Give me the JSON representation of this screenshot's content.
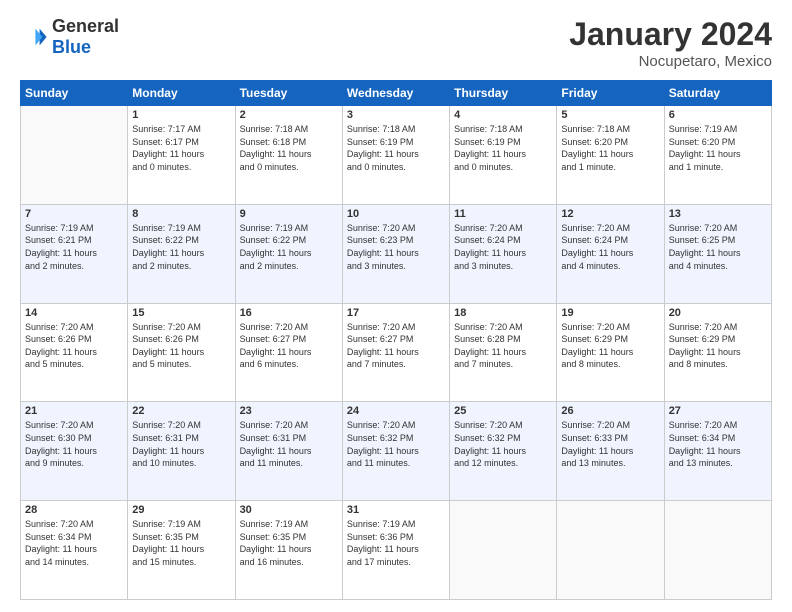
{
  "header": {
    "logo_general": "General",
    "logo_blue": "Blue",
    "month": "January 2024",
    "location": "Nocupetaro, Mexico"
  },
  "weekdays": [
    "Sunday",
    "Monday",
    "Tuesday",
    "Wednesday",
    "Thursday",
    "Friday",
    "Saturday"
  ],
  "weeks": [
    [
      {
        "day": "",
        "info": ""
      },
      {
        "day": "1",
        "info": "Sunrise: 7:17 AM\nSunset: 6:17 PM\nDaylight: 11 hours\nand 0 minutes."
      },
      {
        "day": "2",
        "info": "Sunrise: 7:18 AM\nSunset: 6:18 PM\nDaylight: 11 hours\nand 0 minutes."
      },
      {
        "day": "3",
        "info": "Sunrise: 7:18 AM\nSunset: 6:19 PM\nDaylight: 11 hours\nand 0 minutes."
      },
      {
        "day": "4",
        "info": "Sunrise: 7:18 AM\nSunset: 6:19 PM\nDaylight: 11 hours\nand 0 minutes."
      },
      {
        "day": "5",
        "info": "Sunrise: 7:18 AM\nSunset: 6:20 PM\nDaylight: 11 hours\nand 1 minute."
      },
      {
        "day": "6",
        "info": "Sunrise: 7:19 AM\nSunset: 6:20 PM\nDaylight: 11 hours\nand 1 minute."
      }
    ],
    [
      {
        "day": "7",
        "info": "Sunrise: 7:19 AM\nSunset: 6:21 PM\nDaylight: 11 hours\nand 2 minutes."
      },
      {
        "day": "8",
        "info": "Sunrise: 7:19 AM\nSunset: 6:22 PM\nDaylight: 11 hours\nand 2 minutes."
      },
      {
        "day": "9",
        "info": "Sunrise: 7:19 AM\nSunset: 6:22 PM\nDaylight: 11 hours\nand 2 minutes."
      },
      {
        "day": "10",
        "info": "Sunrise: 7:20 AM\nSunset: 6:23 PM\nDaylight: 11 hours\nand 3 minutes."
      },
      {
        "day": "11",
        "info": "Sunrise: 7:20 AM\nSunset: 6:24 PM\nDaylight: 11 hours\nand 3 minutes."
      },
      {
        "day": "12",
        "info": "Sunrise: 7:20 AM\nSunset: 6:24 PM\nDaylight: 11 hours\nand 4 minutes."
      },
      {
        "day": "13",
        "info": "Sunrise: 7:20 AM\nSunset: 6:25 PM\nDaylight: 11 hours\nand 4 minutes."
      }
    ],
    [
      {
        "day": "14",
        "info": "Sunrise: 7:20 AM\nSunset: 6:26 PM\nDaylight: 11 hours\nand 5 minutes."
      },
      {
        "day": "15",
        "info": "Sunrise: 7:20 AM\nSunset: 6:26 PM\nDaylight: 11 hours\nand 5 minutes."
      },
      {
        "day": "16",
        "info": "Sunrise: 7:20 AM\nSunset: 6:27 PM\nDaylight: 11 hours\nand 6 minutes."
      },
      {
        "day": "17",
        "info": "Sunrise: 7:20 AM\nSunset: 6:27 PM\nDaylight: 11 hours\nand 7 minutes."
      },
      {
        "day": "18",
        "info": "Sunrise: 7:20 AM\nSunset: 6:28 PM\nDaylight: 11 hours\nand 7 minutes."
      },
      {
        "day": "19",
        "info": "Sunrise: 7:20 AM\nSunset: 6:29 PM\nDaylight: 11 hours\nand 8 minutes."
      },
      {
        "day": "20",
        "info": "Sunrise: 7:20 AM\nSunset: 6:29 PM\nDaylight: 11 hours\nand 8 minutes."
      }
    ],
    [
      {
        "day": "21",
        "info": "Sunrise: 7:20 AM\nSunset: 6:30 PM\nDaylight: 11 hours\nand 9 minutes."
      },
      {
        "day": "22",
        "info": "Sunrise: 7:20 AM\nSunset: 6:31 PM\nDaylight: 11 hours\nand 10 minutes."
      },
      {
        "day": "23",
        "info": "Sunrise: 7:20 AM\nSunset: 6:31 PM\nDaylight: 11 hours\nand 11 minutes."
      },
      {
        "day": "24",
        "info": "Sunrise: 7:20 AM\nSunset: 6:32 PM\nDaylight: 11 hours\nand 11 minutes."
      },
      {
        "day": "25",
        "info": "Sunrise: 7:20 AM\nSunset: 6:32 PM\nDaylight: 11 hours\nand 12 minutes."
      },
      {
        "day": "26",
        "info": "Sunrise: 7:20 AM\nSunset: 6:33 PM\nDaylight: 11 hours\nand 13 minutes."
      },
      {
        "day": "27",
        "info": "Sunrise: 7:20 AM\nSunset: 6:34 PM\nDaylight: 11 hours\nand 13 minutes."
      }
    ],
    [
      {
        "day": "28",
        "info": "Sunrise: 7:20 AM\nSunset: 6:34 PM\nDaylight: 11 hours\nand 14 minutes."
      },
      {
        "day": "29",
        "info": "Sunrise: 7:19 AM\nSunset: 6:35 PM\nDaylight: 11 hours\nand 15 minutes."
      },
      {
        "day": "30",
        "info": "Sunrise: 7:19 AM\nSunset: 6:35 PM\nDaylight: 11 hours\nand 16 minutes."
      },
      {
        "day": "31",
        "info": "Sunrise: 7:19 AM\nSunset: 6:36 PM\nDaylight: 11 hours\nand 17 minutes."
      },
      {
        "day": "",
        "info": ""
      },
      {
        "day": "",
        "info": ""
      },
      {
        "day": "",
        "info": ""
      }
    ]
  ]
}
